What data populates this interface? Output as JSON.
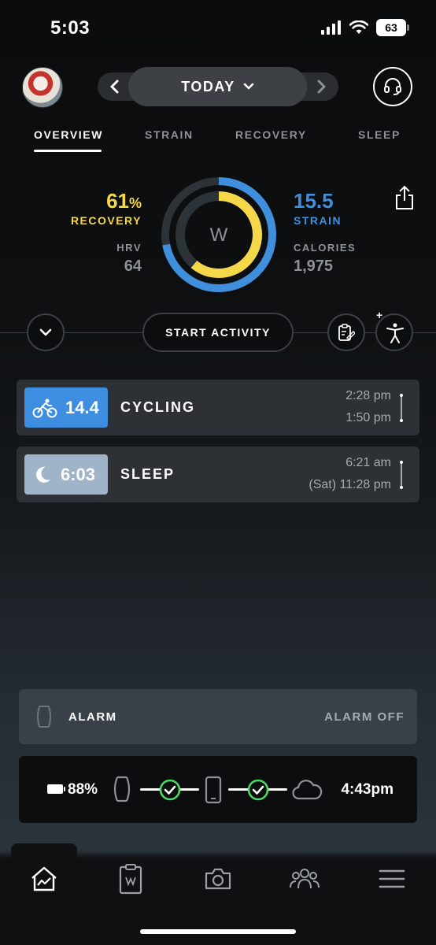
{
  "status_bar": {
    "time": "5:03",
    "battery": "63"
  },
  "header": {
    "date_label": "TODAY",
    "prev_icon": "chevron-left-icon",
    "next_icon": "chevron-right-icon",
    "support_icon": "headset-icon"
  },
  "tabs": [
    {
      "label": "OVERVIEW",
      "active": true
    },
    {
      "label": "STRAIN",
      "active": false
    },
    {
      "label": "RECOVERY",
      "active": false
    },
    {
      "label": "SLEEP",
      "active": false
    }
  ],
  "overview": {
    "recovery": {
      "value": "61",
      "unit": "%",
      "label": "RECOVERY",
      "fraction": 0.61,
      "color": "#f5d84a"
    },
    "hrv": {
      "label": "HRV",
      "value": "64"
    },
    "strain": {
      "value": "15.5",
      "label": "STRAIN",
      "fraction": 0.72,
      "color": "#3f8fdc"
    },
    "calories": {
      "label": "CALORIES",
      "value": "1,975"
    },
    "logo_text": "W"
  },
  "actions": {
    "start_activity": "START ACTIVITY"
  },
  "activities": [
    {
      "strain": "14.4",
      "name": "CYCLING",
      "end": "2:28 pm",
      "start": "1:50 pm",
      "color": "#3d8ee0",
      "icon": "cycling-icon"
    },
    {
      "strain": "6:03",
      "name": "SLEEP",
      "end": "6:21 am",
      "start": "(Sat) 11:28 pm",
      "color": "#9fb3c9",
      "icon": "moon-icon"
    }
  ],
  "alarm": {
    "label": "ALARM",
    "status": "ALARM OFF"
  },
  "sync": {
    "battery": "88%",
    "last_sync": "4:43pm",
    "accent": "#4cd964"
  },
  "bottom_nav": [
    {
      "name": "home",
      "icon": "home-chart-icon"
    },
    {
      "name": "journal",
      "icon": "clipboard-icon"
    },
    {
      "name": "camera",
      "icon": "camera-icon"
    },
    {
      "name": "community",
      "icon": "people-icon"
    },
    {
      "name": "menu",
      "icon": "hamburger-icon"
    }
  ]
}
